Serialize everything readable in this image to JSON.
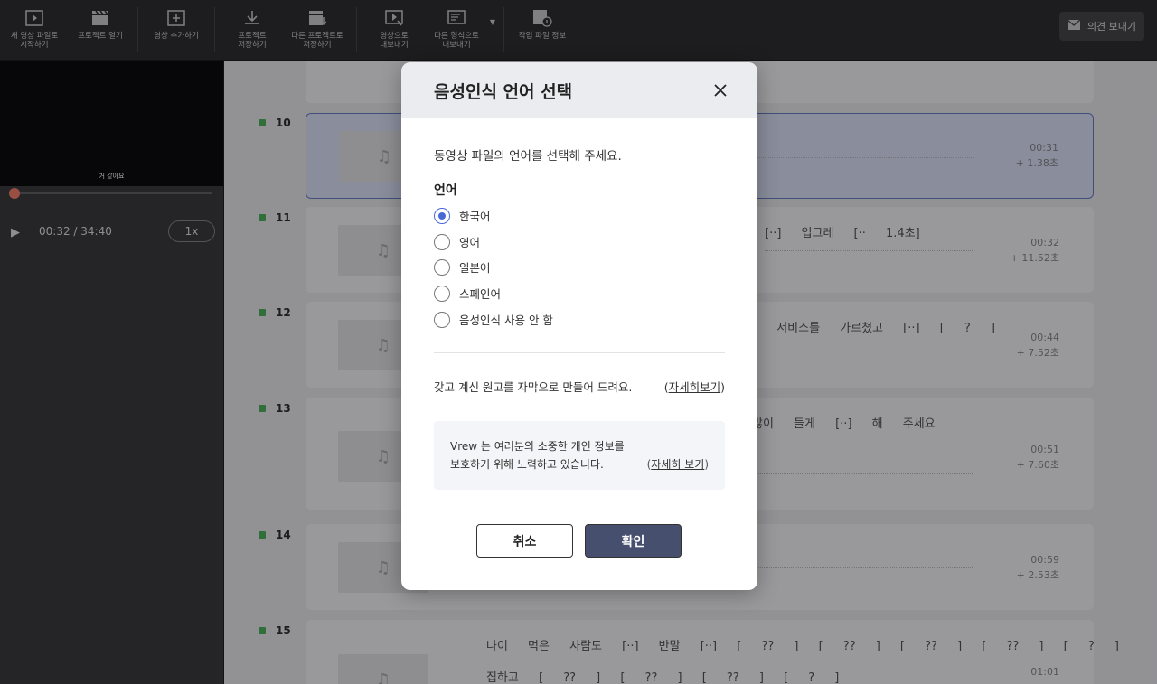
{
  "toolbar": {
    "items": [
      {
        "label": "새 영상 파일로\n시작하기",
        "icon": "new-video-icon"
      },
      {
        "label": "프로젝트 열기",
        "icon": "clapperboard-icon"
      },
      {
        "label": "영상 추가하기",
        "icon": "add-box-icon"
      },
      {
        "label": "프로젝트\n저장하기",
        "icon": "download-icon"
      },
      {
        "label": "다른 프로젝트로\n저장하기",
        "icon": "clapperboard-save-icon"
      },
      {
        "label": "영상으로\n내보내기",
        "icon": "export-video-icon"
      },
      {
        "label": "다른 형식으로\n내보내기",
        "icon": "export-format-icon"
      },
      {
        "label": "작업 파일 정보",
        "icon": "file-info-icon"
      }
    ],
    "feedback_label": "의견 보내기"
  },
  "player": {
    "subtitle": "거 같아요",
    "time": "00:32 / 34:40",
    "speed": "1x"
  },
  "rows": [
    {
      "num": "10",
      "time": "00:31",
      "delta": "+  1.38초",
      "words": ""
    },
    {
      "num": "11",
      "time": "00:32",
      "delta": "+  11.52초",
      "words": "[··]   업그레   [·· 1.4초]"
    },
    {
      "num": "12",
      "time": "00:44",
      "delta": "+  7.52초",
      "words": "]   서비스를   가르쳤고   [··]   [ ? ]"
    },
    {
      "num": "13",
      "time": "00:51",
      "delta": "+  7.60초",
      "words": "많이   들게   [··]   해   주세요"
    },
    {
      "num": "14",
      "time": "00:59",
      "delta": "+  2.53초",
      "words": ""
    },
    {
      "num": "15",
      "time": "01:01",
      "delta": "",
      "words": "나이   먹은   사람도   [··]   반말   [··]   [ ?? ]   [ ?? ]   [ ?? ]   [ ?? ]   [ ? ]",
      "words2": "집하고   [ ?? ]   [ ?? ]   [ ?? ]   [ ? ]"
    }
  ],
  "modal": {
    "title": "음성인식 언어 선택",
    "description": "동영상 파일의 언어를 선택해 주세요.",
    "language_label": "언어",
    "options": [
      "한국어",
      "영어",
      "일본어",
      "스페인어",
      "음성인식 사용 안 함"
    ],
    "selected": "한국어",
    "script_text": "갖고 계신 원고를 자막으로 만들어 드려요.",
    "script_link": "자세히보기",
    "privacy_line1": "Vrew 는 여러분의 소중한 개인 정보를",
    "privacy_line2": "보호하기 위해 노력하고 있습니다.",
    "privacy_link": "자세히 보기",
    "cancel": "취소",
    "confirm": "확인"
  }
}
